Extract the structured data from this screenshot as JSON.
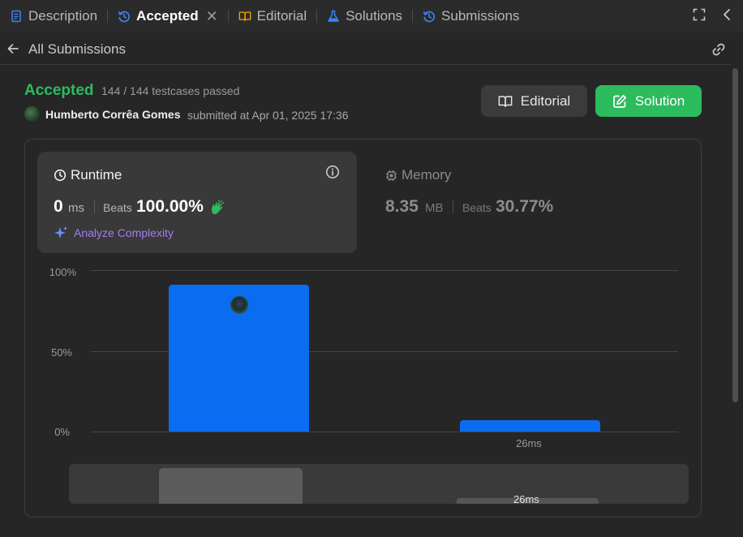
{
  "tabs": [
    {
      "label": "Description",
      "icon": "description-icon",
      "color": "#3b82f6"
    },
    {
      "label": "Accepted",
      "icon": "history-icon",
      "color": "#3b82f6",
      "active": true
    },
    {
      "label": "Editorial",
      "icon": "book-icon",
      "color": "#f0a500"
    },
    {
      "label": "Solutions",
      "icon": "flask-icon",
      "color": "#3b82f6"
    },
    {
      "label": "Submissions",
      "icon": "history-icon",
      "color": "#3b82f6"
    }
  ],
  "back": {
    "label": "All Submissions"
  },
  "submission": {
    "status": "Accepted",
    "testcases": "144 / 144 testcases passed",
    "author": "Humberto Corrêa Gomes",
    "submitted_at": "submitted at Apr 01, 2025 17:36"
  },
  "buttons": {
    "editorial": "Editorial",
    "solution": "Solution"
  },
  "runtime": {
    "title": "Runtime",
    "value": "0",
    "unit": "ms",
    "beats_label": "Beats",
    "beats_value": "100.00%",
    "analyze_label": "Analyze Complexity"
  },
  "memory": {
    "title": "Memory",
    "value": "8.35",
    "unit": "MB",
    "beats_label": "Beats",
    "beats_value": "30.77%"
  },
  "colors": {
    "accepted": "#2cbb5d",
    "bar": "#0a6cf0",
    "analyze": "#a77bf0"
  },
  "chart_data": {
    "type": "bar",
    "y_tick_labels": [
      "100%",
      "50%",
      "0%"
    ],
    "ylim": [
      0,
      100
    ],
    "bars": [
      {
        "label": "",
        "value": 91,
        "has_avatar": true
      },
      {
        "label": "26ms",
        "value": 7,
        "has_avatar": false
      }
    ],
    "minimap_label": "26ms",
    "grid": true
  }
}
